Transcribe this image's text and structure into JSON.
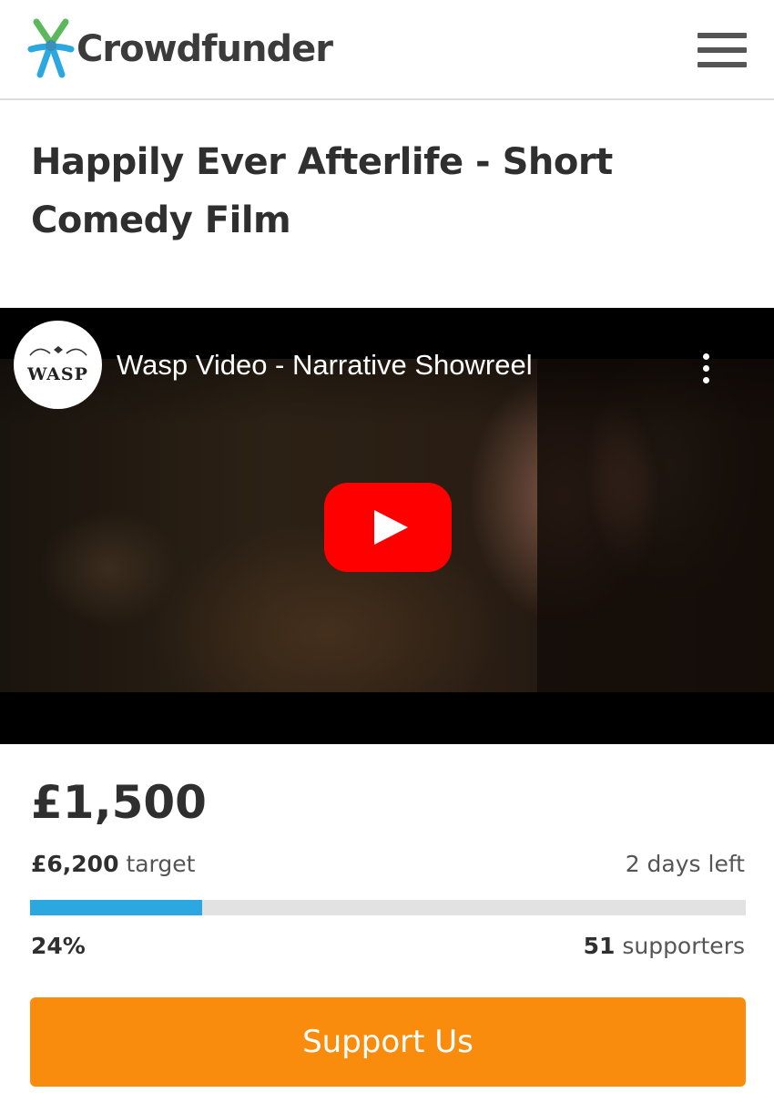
{
  "header": {
    "logo_text": "Crowdfunder",
    "logo_icon": "crowdfunder-logo-icon",
    "menu_icon": "hamburger-menu-icon"
  },
  "project": {
    "title": "Happily Ever Afterlife - Short Comedy Film"
  },
  "video": {
    "channel_name": "WASP",
    "title": "Wasp Video - Narrative Showreel",
    "play_icon": "youtube-play-icon",
    "more_icon": "more-vertical-icon"
  },
  "stats": {
    "raised": "£1,500",
    "target_amount": "£6,200",
    "target_label": "target",
    "days_left": "2 days left",
    "percent": "24%",
    "progress_fraction": 0.24,
    "supporters_count": "51",
    "supporters_label": "supporters"
  },
  "cta": {
    "support_label": "Support Us"
  },
  "colors": {
    "accent_orange": "#fa8c0d",
    "progress_blue": "#2aa8df",
    "youtube_red": "#ff0000",
    "logo_green": "#5cb85c",
    "logo_blue": "#2aa8df"
  }
}
